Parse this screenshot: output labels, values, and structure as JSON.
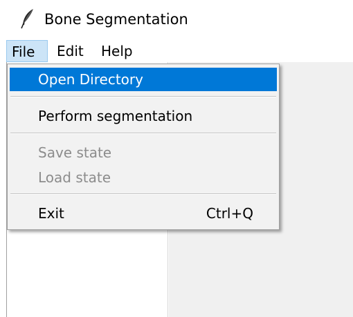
{
  "window": {
    "title": "Bone Segmentation",
    "icon": "feather-icon"
  },
  "menubar": {
    "items": [
      {
        "label": "File",
        "active": true
      },
      {
        "label": "Edit"
      },
      {
        "label": "Help"
      }
    ]
  },
  "file_menu": {
    "items": [
      {
        "label": "Open Directory",
        "highlighted": true
      },
      {
        "label": "Perform segmentation"
      },
      {
        "label": "Save state",
        "disabled": true
      },
      {
        "label": "Load state",
        "disabled": true
      },
      {
        "label": "Exit",
        "shortcut": "Ctrl+Q"
      }
    ]
  },
  "colors": {
    "highlight": "#0078d7",
    "menubar_active": "#cce4f7",
    "disabled_text": "#8c8c8c",
    "panel_background": "#f0f0f0"
  }
}
